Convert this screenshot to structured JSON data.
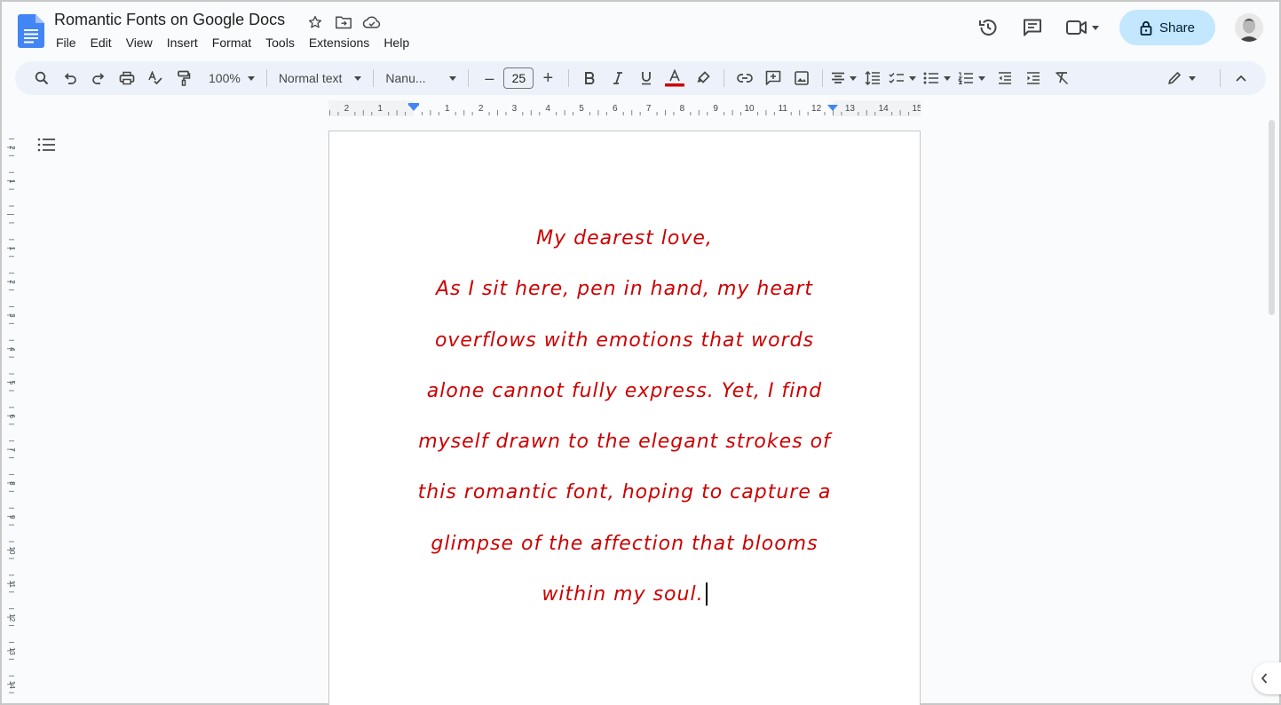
{
  "document": {
    "title": "Romantic Fonts on Google Docs"
  },
  "menu": {
    "items": [
      "File",
      "Edit",
      "View",
      "Insert",
      "Format",
      "Tools",
      "Extensions",
      "Help"
    ]
  },
  "header": {
    "share_label": "Share"
  },
  "toolbar": {
    "zoom": "100%",
    "style": "Normal text",
    "font": "Nanu...",
    "font_size": "25",
    "minus": "–",
    "plus": "+"
  },
  "ruler": {
    "labels": [
      "2",
      "1",
      "1",
      "2",
      "3",
      "4",
      "5",
      "6",
      "7",
      "8",
      "9",
      "10",
      "11",
      "12",
      "13",
      "14",
      "15"
    ],
    "vertical_labels": [
      "2",
      "1",
      "1",
      "2",
      "3",
      "4",
      "5",
      "6",
      "7",
      "8",
      "9",
      "10",
      "11",
      "12",
      "13",
      "14"
    ]
  },
  "body": {
    "lines": [
      "My dearest love,",
      "As I sit here, pen in hand, my heart",
      "overflows with emotions that words",
      "alone cannot fully express. Yet, I find",
      "myself drawn to the elegant strokes of",
      "this romantic font, hoping to capture a",
      "glimpse of the affection that blooms",
      "within my soul."
    ]
  },
  "colors": {
    "text": "#cc0000",
    "share_bg": "#c2e7ff",
    "toolbar_bg": "#edf2fa",
    "doc_blue": "#4285f4"
  },
  "icons": {
    "logo": "docs-logo-icon",
    "star": "star-icon",
    "move": "folder-move-icon",
    "cloud": "cloud-saved-icon",
    "history": "history-icon",
    "comments": "comment-icon",
    "meet": "video-call-icon",
    "lock": "lock-icon"
  }
}
